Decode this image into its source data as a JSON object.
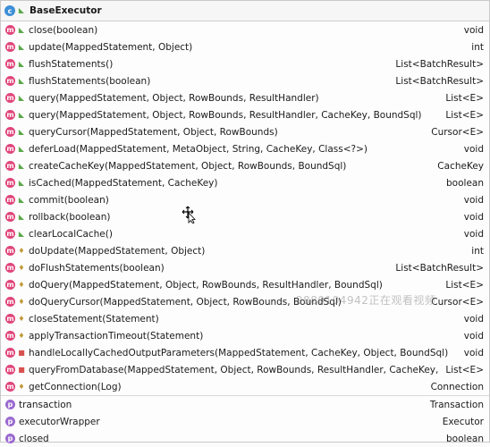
{
  "header": {
    "title": "BaseExecutor",
    "icon": "class-icon"
  },
  "rows": [
    {
      "kind": "m",
      "vis": "public",
      "sig": "close(boolean)",
      "ret": "void"
    },
    {
      "kind": "m",
      "vis": "public",
      "sig": "update(MappedStatement, Object)",
      "ret": "int"
    },
    {
      "kind": "m",
      "vis": "public",
      "sig": "flushStatements()",
      "ret": "List<BatchResult>"
    },
    {
      "kind": "m",
      "vis": "public",
      "sig": "flushStatements(boolean)",
      "ret": "List<BatchResult>"
    },
    {
      "kind": "m",
      "vis": "public",
      "sig": "query(MappedStatement, Object, RowBounds, ResultHandler)",
      "ret": "List<E>"
    },
    {
      "kind": "m",
      "vis": "public",
      "sig": "query(MappedStatement, Object, RowBounds, ResultHandler, CacheKey, BoundSql)",
      "ret": "List<E>"
    },
    {
      "kind": "m",
      "vis": "public",
      "sig": "queryCursor(MappedStatement, Object, RowBounds)",
      "ret": "Cursor<E>"
    },
    {
      "kind": "m",
      "vis": "public",
      "sig": "deferLoad(MappedStatement, MetaObject, String, CacheKey, Class<?>)",
      "ret": "void"
    },
    {
      "kind": "m",
      "vis": "public",
      "sig": "createCacheKey(MappedStatement, Object, RowBounds, BoundSql)",
      "ret": "CacheKey"
    },
    {
      "kind": "m",
      "vis": "public",
      "sig": "isCached(MappedStatement, CacheKey)",
      "ret": "boolean"
    },
    {
      "kind": "m",
      "vis": "public",
      "sig": "commit(boolean)",
      "ret": "void"
    },
    {
      "kind": "m",
      "vis": "public",
      "sig": "rollback(boolean)",
      "ret": "void"
    },
    {
      "kind": "m",
      "vis": "public",
      "sig": "clearLocalCache()",
      "ret": "void"
    },
    {
      "kind": "m",
      "vis": "protected",
      "sig": "doUpdate(MappedStatement, Object)",
      "ret": "int"
    },
    {
      "kind": "m",
      "vis": "protected",
      "sig": "doFlushStatements(boolean)",
      "ret": "List<BatchResult>"
    },
    {
      "kind": "m",
      "vis": "protected",
      "sig": "doQuery(MappedStatement, Object, RowBounds, ResultHandler, BoundSql)",
      "ret": "List<E>"
    },
    {
      "kind": "m",
      "vis": "protected",
      "sig": "doQueryCursor(MappedStatement, Object, RowBounds, BoundSql)",
      "ret": "Cursor<E>"
    },
    {
      "kind": "m",
      "vis": "protected",
      "sig": "closeStatement(Statement)",
      "ret": "void"
    },
    {
      "kind": "m",
      "vis": "protected",
      "sig": "applyTransactionTimeout(Statement)",
      "ret": "void"
    },
    {
      "kind": "m",
      "vis": "private",
      "sig": "handleLocallyCachedOutputParameters(MappedStatement, CacheKey, Object, BoundSql)",
      "ret": "void"
    },
    {
      "kind": "m",
      "vis": "private",
      "sig": "queryFromDatabase(MappedStatement, Object, RowBounds, ResultHandler, CacheKey, BoundSql)",
      "ret": "List<E>"
    },
    {
      "kind": "m",
      "vis": "protected",
      "sig": "getConnection(Log)",
      "ret": "Connection"
    }
  ],
  "fields": [
    {
      "kind": "p",
      "sig": "transaction",
      "ret": "Transaction"
    },
    {
      "kind": "p",
      "sig": "executorWrapper",
      "ret": "Executor"
    },
    {
      "kind": "p",
      "sig": "closed",
      "ret": "boolean"
    }
  ],
  "watermark": "2880104942正在观看视频"
}
